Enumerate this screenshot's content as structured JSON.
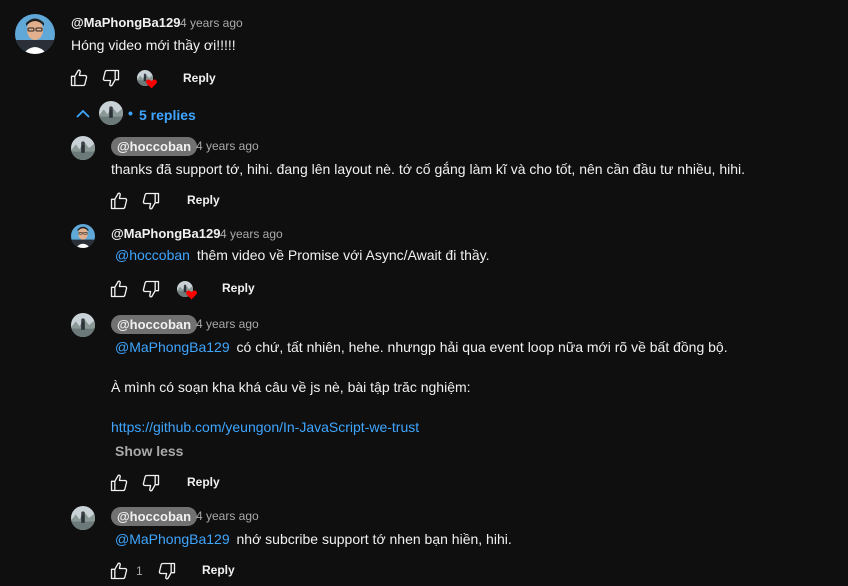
{
  "colors": {
    "background": "#0f0f0f",
    "text": "#f1f1f1",
    "secondary": "#aaaaaa",
    "link": "#3ea6ff",
    "heart": "#ff0000",
    "creator_pill": "#717171"
  },
  "top_comment": {
    "author": "@MaPhongBa129",
    "time": "4 years ago",
    "text": "Hóng video mới thầy ơi!!!!!",
    "reply_label": "Reply",
    "icons": [
      "thumbs-up-icon",
      "thumbs-down-icon",
      "creator-heart-icon"
    ]
  },
  "replies_toggle": {
    "label": "5 replies",
    "icon": "chevron-up-icon"
  },
  "replies": [
    {
      "author": "@hoccoban",
      "time": "4 years ago",
      "text": "thanks đã support tớ, hihi. đang lên layout nè. tớ cố gắng làm kĩ và cho tốt, nên cần đầu tư nhiều, hihi.",
      "reply_label": "Reply"
    },
    {
      "author": "@MaPhongBa129",
      "time": "4 years ago",
      "mention": "@hoccoban",
      "text": "thêm video về Promise với Async/Await đi thầy.",
      "reply_label": "Reply"
    },
    {
      "author": "@hoccoban",
      "time": "4 years ago",
      "mention": "@MaPhongBa129",
      "text": "có chứ, tất nhiên, hehe. nhưngp hải qua event loop nữa mới rõ về bất đồng bộ.",
      "line2": "À mình có soạn kha khá câu về js nè, bài tập trăc nghiệm:",
      "link": "https://github.com/yeungon/In-JavaScript-we-trust",
      "show_less": "Show less",
      "reply_label": "Reply"
    },
    {
      "author": "@hoccoban",
      "time": "4 years ago",
      "mention": "@MaPhongBa129",
      "text": "nhớ subcribe support tớ nhen bạn hiền, hihi.",
      "like_count": "1",
      "reply_label": "Reply"
    }
  ]
}
